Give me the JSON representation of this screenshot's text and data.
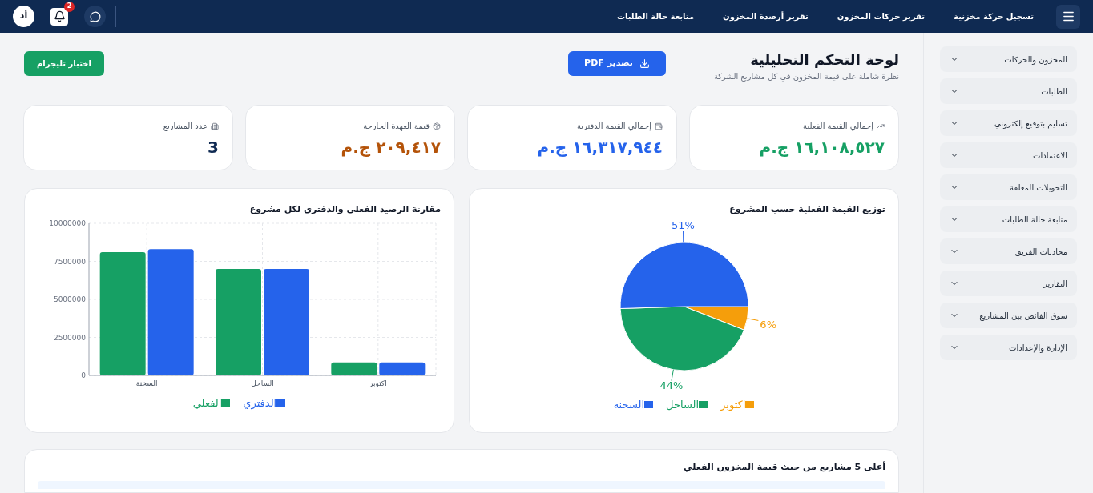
{
  "topbar": {
    "nav_links": [
      "تسجيل حركة مخزنية",
      "تقرير حركات المخزون",
      "تقرير أرصدة المخزون",
      "متابعة حالة الطلبات"
    ],
    "notification_count": "2",
    "avatar": "أد"
  },
  "sidebar": {
    "items": [
      {
        "label": "المخزون والحركات",
        "expanded": false
      },
      {
        "label": "الطلبات",
        "expanded": false
      },
      {
        "label": "تسليم بتوقيع إلكتروني",
        "expanded": false
      },
      {
        "label": "الاعتمادات",
        "expanded": false
      },
      {
        "label": "التحويلات المعلقة",
        "expanded": false
      },
      {
        "label": "متابعة حالة الطلبات",
        "expanded": false
      },
      {
        "label": "محادثات الفريق",
        "expanded": false
      },
      {
        "label": "التقارير",
        "expanded": false
      },
      {
        "label": "سوق الفائض بين المشاريع",
        "expanded": false
      },
      {
        "label": "الإدارة والإعدادات",
        "expanded": false
      }
    ]
  },
  "header": {
    "title": "لوحة التحكم التحليلية",
    "subtitle": "نظرة شاملة على قيمة المخزون في كل مشاريع الشركة",
    "export_button": "تصدير PDF",
    "telegram_button": "اختبار تليجرام"
  },
  "stats": [
    {
      "kind": "trend",
      "label": "إجمالي القيمة الفعلية",
      "value": "١٦,١٠٨,٥٢٧ ج.م",
      "color": "#16a064"
    },
    {
      "kind": "wallet",
      "label": "إجمالي القيمة الدفترية",
      "value": "١٦,٣١٧,٩٤٤ ج.م",
      "color": "#2563eb"
    },
    {
      "kind": "package",
      "label": "قيمة العهدة الخارجة",
      "value": "٢٠٩,٤١٧ ج.م",
      "color": "#b45309"
    },
    {
      "kind": "building",
      "label": "عدد المشاريع",
      "value": "3",
      "color": "#0f2a52"
    }
  ],
  "pie_card": {
    "chart_data": {
      "type": "pie",
      "title": "توزيع القيمة الفعلية حسب المشروع",
      "categories": [
        "اكتوبر",
        "الساحل",
        "السخنة"
      ],
      "values": [
        6,
        44,
        51
      ],
      "value_labels": [
        "6%",
        "44%",
        "51%"
      ],
      "legend": "bottom"
    },
    "legend": [
      {
        "color": "#f59e0b"
      },
      {
        "color": "#16a064"
      },
      {
        "color": "#2563eb"
      }
    ]
  },
  "bar_card": {
    "chart_data": {
      "type": "bar",
      "title": "مقارنة الرصيد الفعلي والدفتري لكل مشروع",
      "categories": [
        "السخنة",
        "الساحل",
        "اكتوبر"
      ],
      "series": [
        {
          "name": "الفعلي",
          "color": "#16a064",
          "values": [
            8100000,
            7000000,
            850000
          ]
        },
        {
          "name": "الدفتري",
          "color": "#2563eb",
          "values": [
            8300000,
            7000000,
            850000
          ]
        }
      ],
      "ylim": [
        0,
        10000000
      ],
      "yticks": [
        0,
        2500000,
        5000000,
        7500000,
        10000000
      ],
      "grid": true,
      "legend": "bottom"
    }
  },
  "top_projects": {
    "title": "أعلى 5 مشاريع من حيث قيمة المخزون الفعلي"
  }
}
